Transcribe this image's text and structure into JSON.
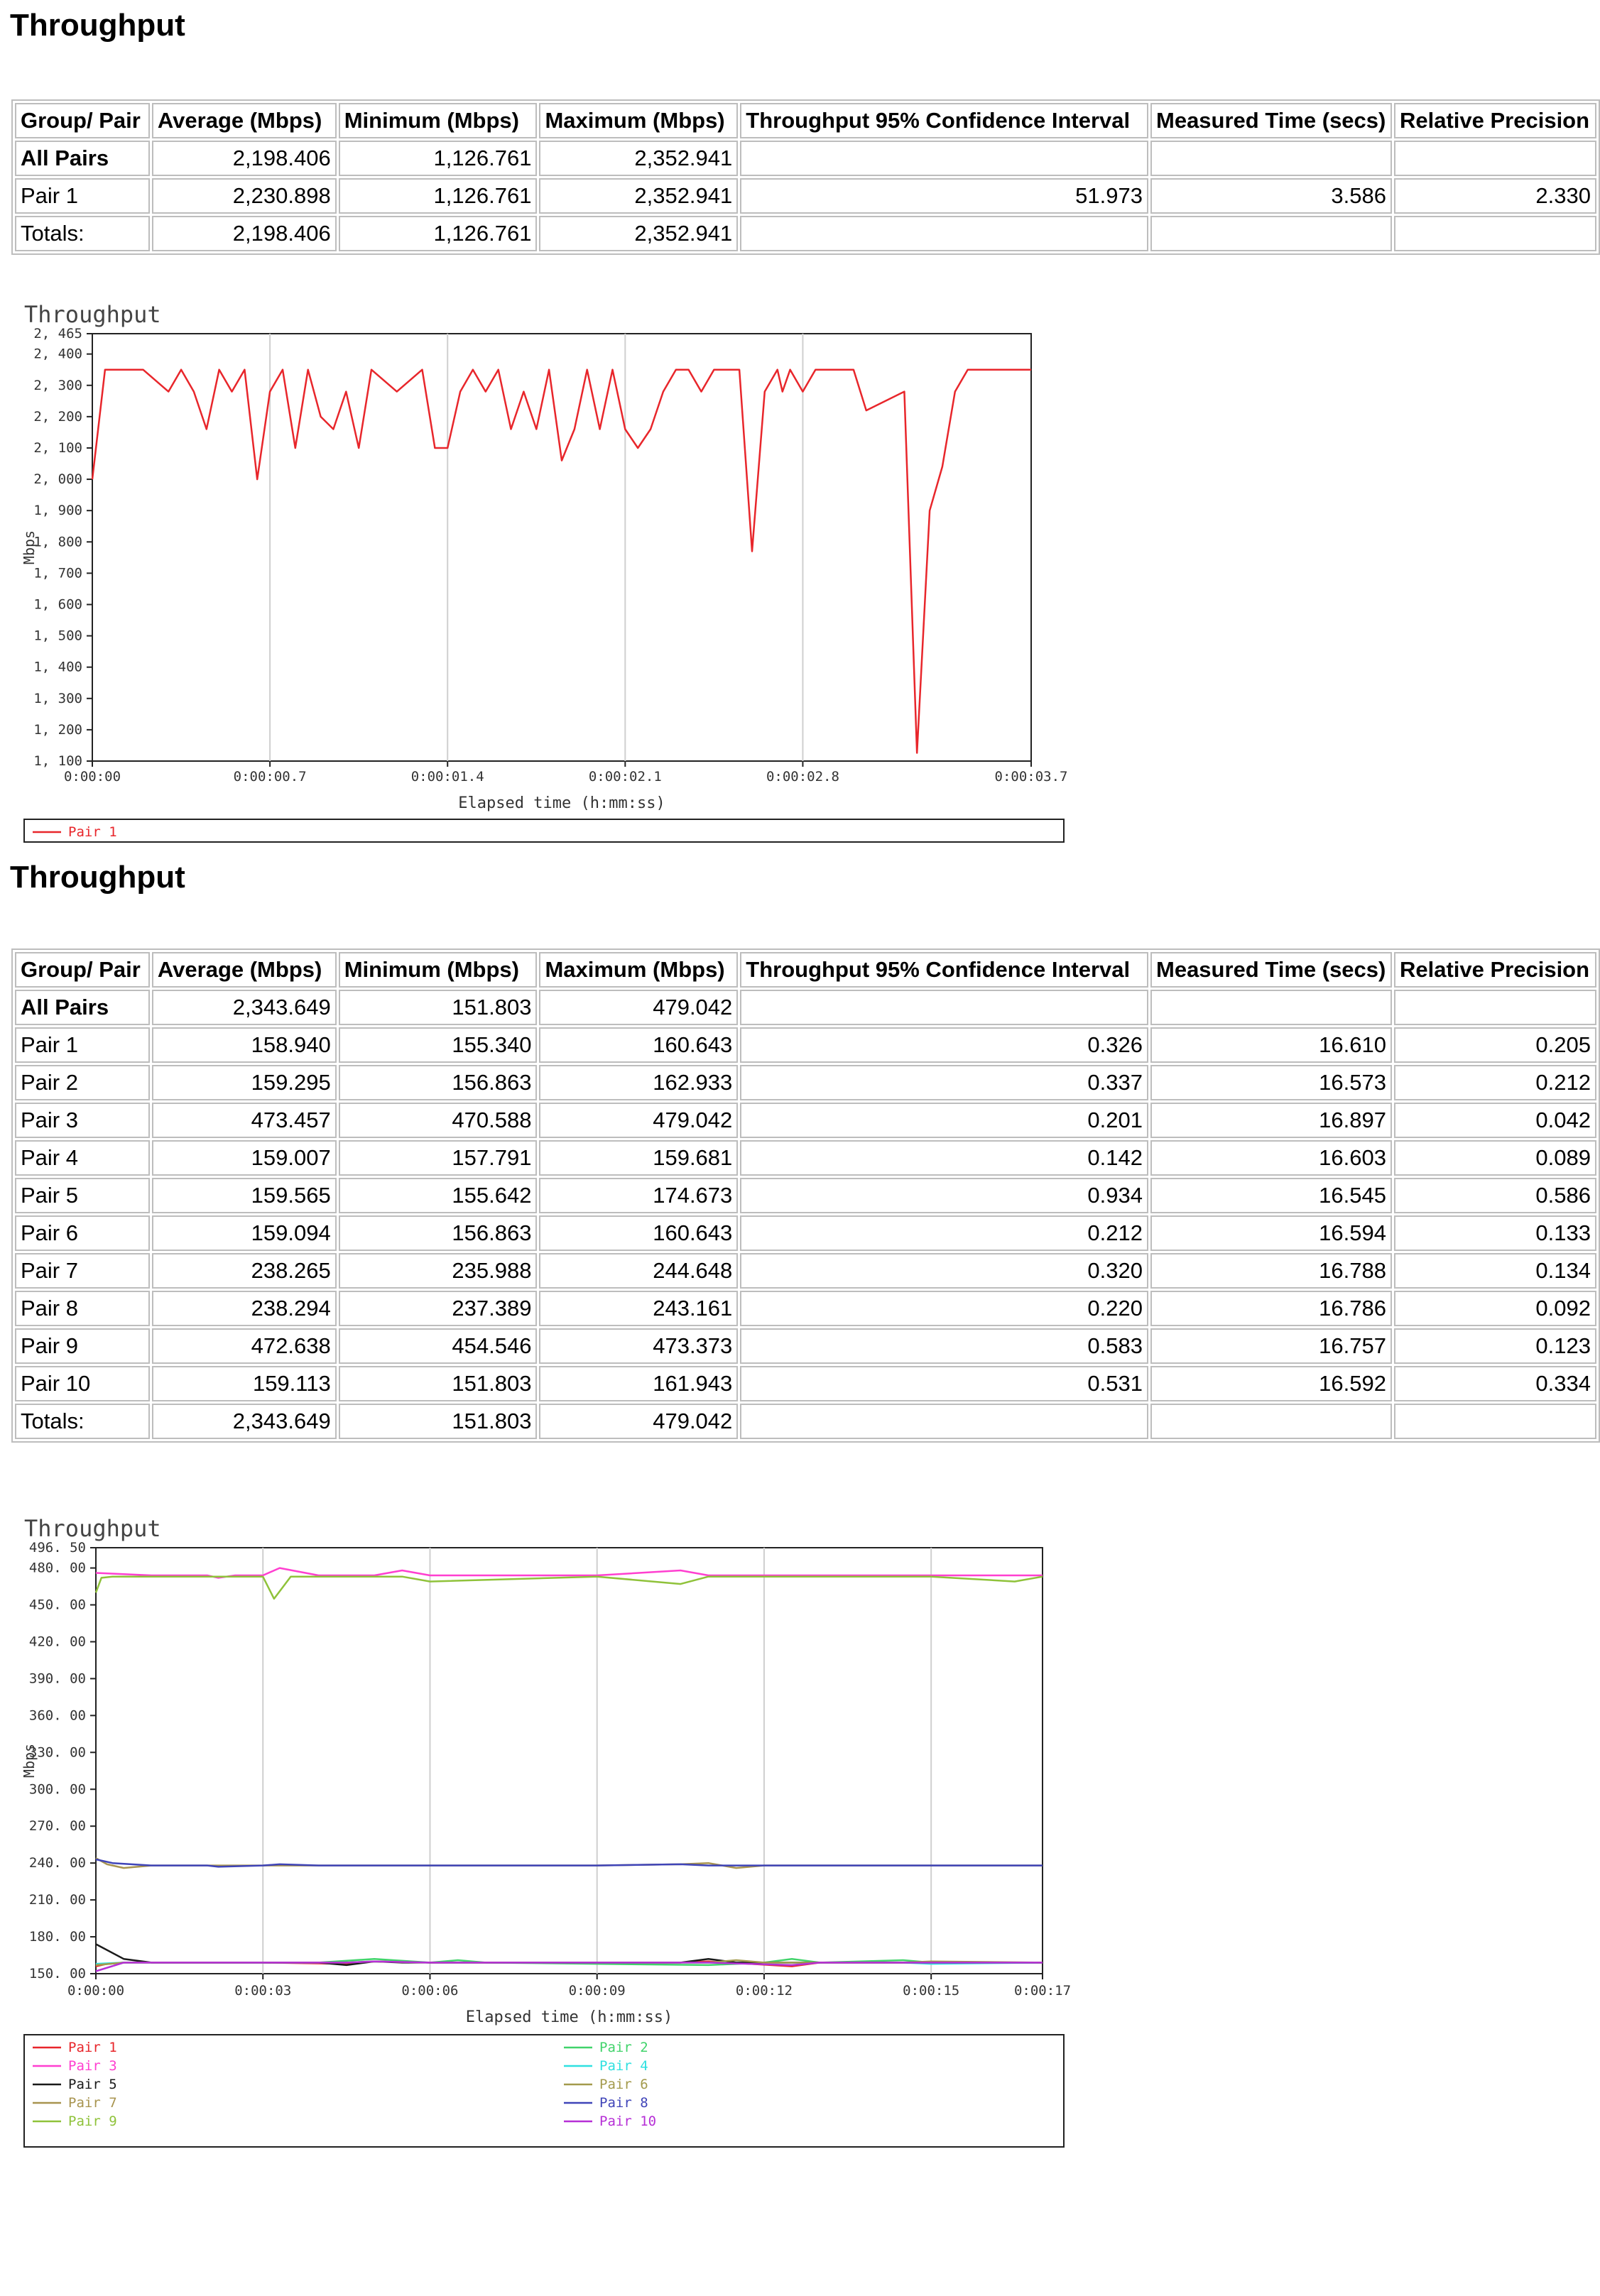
{
  "sections": [
    {
      "title": "Throughput",
      "table": {
        "headers": [
          "Group/ Pair",
          "Average (Mbps)",
          "Minimum (Mbps)",
          "Maximum (Mbps)",
          "Throughput 95% Confidence Interval",
          "Measured Time (secs)",
          "Relative Precision"
        ],
        "rows": [
          [
            "All Pairs",
            "2,198.406",
            "1,126.761",
            "2,352.941",
            "",
            "",
            ""
          ],
          [
            "Pair 1",
            "2,230.898",
            "1,126.761",
            "2,352.941",
            "51.973",
            "3.586",
            "2.330"
          ],
          [
            "Totals:",
            "2,198.406",
            "1,126.761",
            "2,352.941",
            "",
            "",
            ""
          ]
        ]
      }
    },
    {
      "title": "Throughput",
      "table": {
        "headers": [
          "Group/ Pair",
          "Average (Mbps)",
          "Minimum (Mbps)",
          "Maximum (Mbps)",
          "Throughput 95% Confidence Interval",
          "Measured Time (secs)",
          "Relative Precision"
        ],
        "rows": [
          [
            "All Pairs",
            "2,343.649",
            "151.803",
            "479.042",
            "",
            "",
            ""
          ],
          [
            "Pair 1",
            "158.940",
            "155.340",
            "160.643",
            "0.326",
            "16.610",
            "0.205"
          ],
          [
            "Pair 2",
            "159.295",
            "156.863",
            "162.933",
            "0.337",
            "16.573",
            "0.212"
          ],
          [
            "Pair 3",
            "473.457",
            "470.588",
            "479.042",
            "0.201",
            "16.897",
            "0.042"
          ],
          [
            "Pair 4",
            "159.007",
            "157.791",
            "159.681",
            "0.142",
            "16.603",
            "0.089"
          ],
          [
            "Pair 5",
            "159.565",
            "155.642",
            "174.673",
            "0.934",
            "16.545",
            "0.586"
          ],
          [
            "Pair 6",
            "159.094",
            "156.863",
            "160.643",
            "0.212",
            "16.594",
            "0.133"
          ],
          [
            "Pair 7",
            "238.265",
            "235.988",
            "244.648",
            "0.320",
            "16.788",
            "0.134"
          ],
          [
            "Pair 8",
            "238.294",
            "237.389",
            "243.161",
            "0.220",
            "16.786",
            "0.092"
          ],
          [
            "Pair 9",
            "472.638",
            "454.546",
            "473.373",
            "0.583",
            "16.757",
            "0.123"
          ],
          [
            "Pair 10",
            "159.113",
            "151.803",
            "161.943",
            "0.531",
            "16.592",
            "0.334"
          ],
          [
            "Totals:",
            "2,343.649",
            "151.803",
            "479.042",
            "",
            "",
            ""
          ]
        ]
      }
    }
  ],
  "chart_data": [
    {
      "type": "line",
      "title": "Throughput",
      "xlabel": "Elapsed time (h:mm:ss)",
      "ylabel": "Mbps",
      "ylim": [
        1100,
        2465
      ],
      "xlim": [
        0,
        3.7
      ],
      "yticks": [
        1100,
        1200,
        1300,
        1400,
        1500,
        1600,
        1700,
        1800,
        1900,
        2000,
        2100,
        2200,
        2300,
        2400,
        2465
      ],
      "ytick_labels": [
        "1, 100",
        "1, 200",
        "1, 300",
        "1, 400",
        "1, 500",
        "1, 600",
        "1, 700",
        "1, 800",
        "1, 900",
        "2, 000",
        "2, 100",
        "2, 200",
        "2, 300",
        "2, 400",
        "2, 465"
      ],
      "xticks": [
        0,
        0.7,
        1.4,
        2.1,
        2.8,
        3.7
      ],
      "xtick_labels": [
        "0:00:00",
        "0:00:00.7",
        "0:00:01.4",
        "0:00:02.1",
        "0:00:02.8",
        "0:00:03.7"
      ],
      "grid": true,
      "legend": "bottom",
      "series": [
        {
          "name": "Pair 1",
          "color": "#e8262b",
          "x": [
            0,
            0.05,
            0.1,
            0.2,
            0.3,
            0.35,
            0.4,
            0.45,
            0.5,
            0.55,
            0.6,
            0.65,
            0.7,
            0.75,
            0.8,
            0.85,
            0.9,
            0.95,
            1.0,
            1.05,
            1.1,
            1.2,
            1.3,
            1.35,
            1.4,
            1.45,
            1.5,
            1.55,
            1.6,
            1.65,
            1.7,
            1.75,
            1.8,
            1.85,
            1.9,
            1.95,
            2.0,
            2.05,
            2.1,
            2.15,
            2.2,
            2.25,
            2.3,
            2.35,
            2.4,
            2.45,
            2.5,
            2.55,
            2.6,
            2.65,
            2.7,
            2.72,
            2.75,
            2.8,
            2.85,
            2.9,
            2.95,
            3.0,
            3.05,
            3.2,
            3.25,
            3.3,
            3.35,
            3.4,
            3.45,
            3.5,
            3.55,
            3.6,
            3.65,
            3.7
          ],
          "y": [
            2000,
            2350,
            2350,
            2350,
            2280,
            2350,
            2280,
            2160,
            2350,
            2280,
            2350,
            2000,
            2280,
            2350,
            2100,
            2350,
            2200,
            2160,
            2280,
            2100,
            2350,
            2280,
            2350,
            2100,
            2100,
            2280,
            2350,
            2280,
            2350,
            2160,
            2280,
            2160,
            2350,
            2060,
            2160,
            2350,
            2160,
            2350,
            2160,
            2100,
            2160,
            2280,
            2350,
            2350,
            2280,
            2350,
            2350,
            2350,
            1770,
            2280,
            2350,
            2280,
            2350,
            2280,
            2350,
            2350,
            2350,
            2350,
            2220,
            2280,
            1126,
            1900,
            2040,
            2280,
            2350,
            2350,
            2350,
            2350,
            2350,
            2350
          ]
        }
      ]
    },
    {
      "type": "line",
      "title": "Throughput",
      "xlabel": "Elapsed time (h:mm:ss)",
      "ylabel": "Mbps",
      "ylim": [
        150,
        496.5
      ],
      "xlim": [
        0,
        17
      ],
      "yticks": [
        150,
        180,
        210,
        240,
        270,
        300,
        330,
        360,
        390,
        420,
        450,
        480,
        496.5
      ],
      "ytick_labels": [
        "150. 00",
        "180. 00",
        "210. 00",
        "240. 00",
        "270. 00",
        "300. 00",
        "330. 00",
        "360. 00",
        "390. 00",
        "420. 00",
        "450. 00",
        "480. 00",
        "496. 50"
      ],
      "xticks": [
        0,
        3,
        6,
        9,
        12,
        15,
        17
      ],
      "xtick_labels": [
        "0:00:00",
        "0:00:03",
        "0:00:06",
        "0:00:09",
        "0:00:12",
        "0:00:15",
        "0:00:17"
      ],
      "grid": true,
      "legend": "bottom",
      "series": [
        {
          "name": "Pair 1",
          "color": "#e8262b",
          "x": [
            0,
            0.2,
            0.5,
            3,
            4.5,
            5,
            6,
            10.5,
            11,
            12.5,
            13,
            17
          ],
          "y": [
            156,
            158,
            159,
            159,
            158,
            160,
            159,
            159,
            160,
            156,
            159,
            159
          ]
        },
        {
          "name": "Pair 2",
          "color": "#41d36b",
          "x": [
            0,
            0.5,
            4,
            5,
            6,
            6.5,
            7,
            11,
            12,
            12.5,
            13,
            14.5,
            15,
            15.5,
            17
          ],
          "y": [
            157,
            159,
            159,
            162,
            159,
            161,
            159,
            157,
            159,
            162,
            159,
            161,
            159,
            159,
            159
          ]
        },
        {
          "name": "Pair 3",
          "color": "#ff3fd0",
          "x": [
            0,
            1,
            2,
            2.2,
            2.5,
            3,
            3.3,
            4,
            5,
            5.5,
            6,
            9,
            10.5,
            11,
            15,
            17
          ],
          "y": [
            476,
            474,
            474,
            472,
            474,
            474,
            480,
            474,
            474,
            478,
            474,
            474,
            478,
            474,
            474,
            474
          ]
        },
        {
          "name": "Pair 4",
          "color": "#2fe0e0",
          "x": [
            0,
            0.5,
            4.5,
            5,
            6,
            11,
            12,
            14.5,
            15,
            17
          ],
          "y": [
            158,
            159,
            159,
            160,
            159,
            159,
            159,
            159,
            158,
            159
          ]
        },
        {
          "name": "Pair 5",
          "color": "#1a1a1a",
          "x": [
            0,
            0.5,
            1,
            4,
            4.5,
            5,
            5.5,
            10.5,
            11,
            11.5,
            12,
            17
          ],
          "y": [
            174,
            162,
            159,
            159,
            157,
            160,
            159,
            159,
            162,
            159,
            159,
            159
          ]
        },
        {
          "name": "Pair 6",
          "color": "#a39a4c",
          "x": [
            0,
            0.5,
            4.5,
            5,
            6,
            11,
            11.5,
            12,
            14.5,
            15,
            17
          ],
          "y": [
            157,
            159,
            159,
            160,
            159,
            159,
            161,
            159,
            159,
            160,
            159
          ]
        },
        {
          "name": "Pair 7",
          "color": "#a8944f",
          "x": [
            0,
            0.2,
            0.5,
            1,
            2,
            3,
            9,
            10.5,
            11,
            11.5,
            12,
            17
          ],
          "y": [
            244,
            239,
            236,
            238,
            238,
            238,
            238,
            239,
            240,
            236,
            238,
            238
          ]
        },
        {
          "name": "Pair 8",
          "color": "#3f44b8",
          "x": [
            0,
            0.3,
            1,
            2,
            2.2,
            3,
            3.3,
            4,
            9,
            10.5,
            11,
            12,
            17
          ],
          "y": [
            243,
            240,
            238,
            238,
            237,
            238,
            239,
            238,
            238,
            239,
            238,
            238,
            238
          ]
        },
        {
          "name": "Pair 9",
          "color": "#8fc23a",
          "x": [
            0,
            0.1,
            0.3,
            3,
            3.2,
            3.5,
            5.5,
            6,
            9,
            10.5,
            11,
            15,
            16.5,
            17
          ],
          "y": [
            460,
            472,
            473,
            473,
            455,
            473,
            473,
            469,
            473,
            467,
            473,
            473,
            469,
            473
          ]
        },
        {
          "name": "Pair 10",
          "color": "#b62fd6",
          "x": [
            0,
            0.5,
            3,
            4.5,
            5,
            6,
            11,
            12.5,
            13,
            17
          ],
          "y": [
            152,
            159,
            159,
            159,
            160,
            159,
            159,
            157,
            159,
            159
          ]
        }
      ]
    }
  ]
}
